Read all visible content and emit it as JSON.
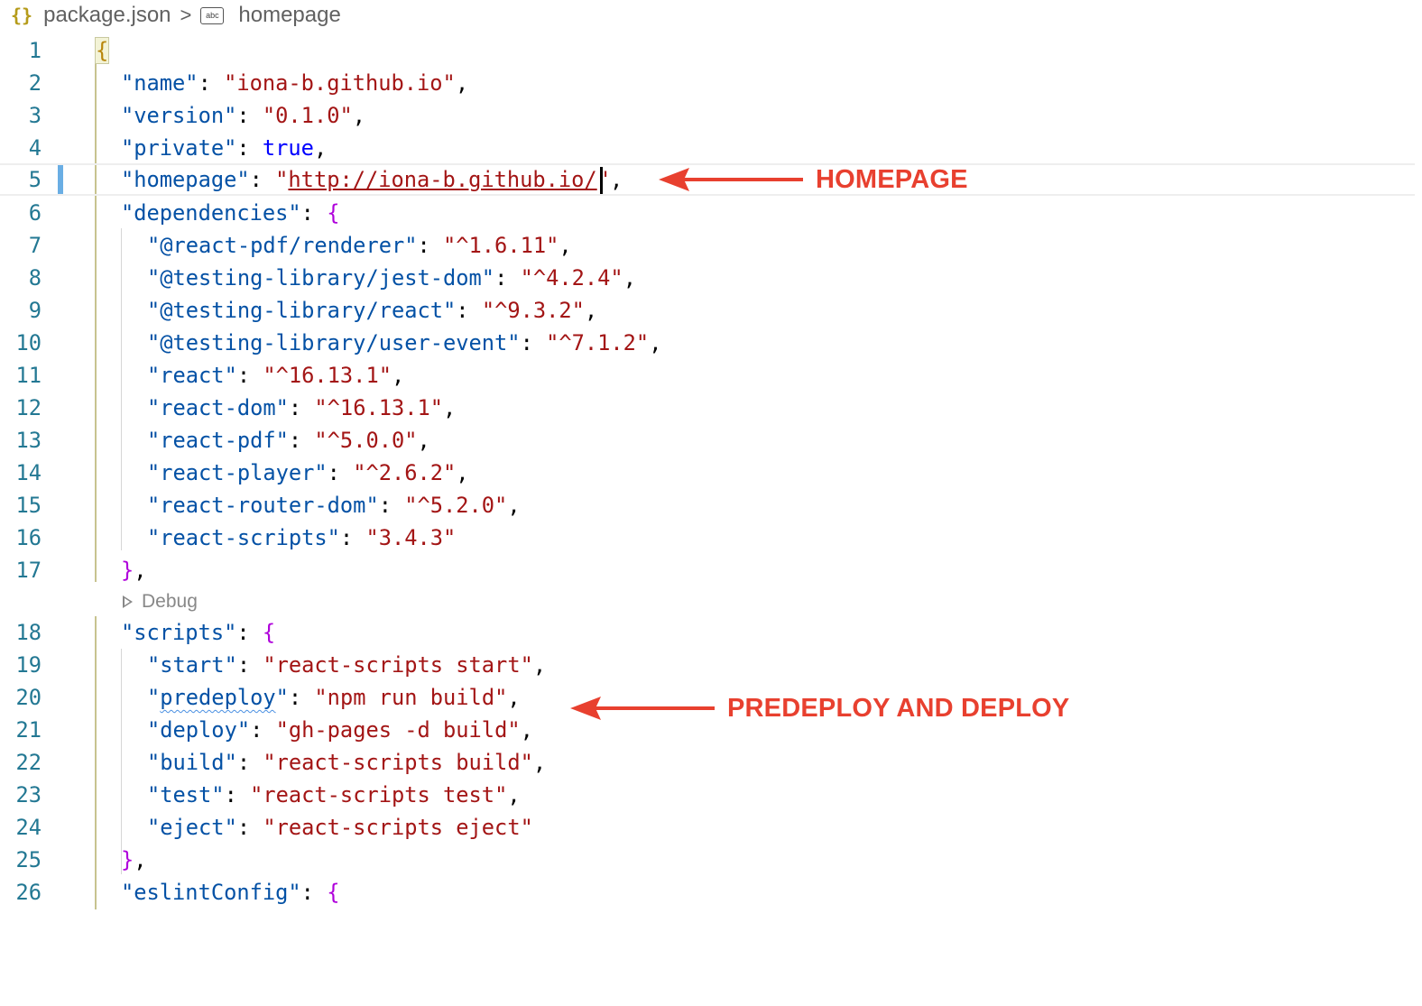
{
  "breadcrumb": {
    "file_icon": "{}",
    "file_name": "package.json",
    "separator": ">",
    "symbol_icon": "abc",
    "symbol_name": "homepage"
  },
  "editor": {
    "current_line": 5,
    "codelens": "Debug",
    "lines": [
      {
        "num": "1"
      },
      {
        "num": "2"
      },
      {
        "num": "3"
      },
      {
        "num": "4"
      },
      {
        "num": "5"
      },
      {
        "num": "6"
      },
      {
        "num": "7"
      },
      {
        "num": "8"
      },
      {
        "num": "9"
      },
      {
        "num": "10"
      },
      {
        "num": "11"
      },
      {
        "num": "12"
      },
      {
        "num": "13"
      },
      {
        "num": "14"
      },
      {
        "num": "15"
      },
      {
        "num": "16"
      },
      {
        "num": "17"
      },
      {
        "num": "18"
      },
      {
        "num": "19"
      },
      {
        "num": "20"
      },
      {
        "num": "21"
      },
      {
        "num": "22"
      },
      {
        "num": "23"
      },
      {
        "num": "24"
      },
      {
        "num": "25"
      },
      {
        "num": "26"
      }
    ],
    "code": {
      "l2_key": "\"name\"",
      "l2_val": "\"iona-b.github.io\"",
      "l3_key": "\"version\"",
      "l3_val": "\"0.1.0\"",
      "l4_key": "\"private\"",
      "l4_val": "true",
      "l5_key": "\"homepage\"",
      "l5_val": "http://iona-b.github.io/",
      "l6_key": "\"dependencies\"",
      "l7_key": "\"@react-pdf/renderer\"",
      "l7_val": "\"^1.6.11\"",
      "l8_key": "\"@testing-library/jest-dom\"",
      "l8_val": "\"^4.2.4\"",
      "l9_key": "\"@testing-library/react\"",
      "l9_val": "\"^9.3.2\"",
      "l10_key": "\"@testing-library/user-event\"",
      "l10_val": "\"^7.1.2\"",
      "l11_key": "\"react\"",
      "l11_val": "\"^16.13.1\"",
      "l12_key": "\"react-dom\"",
      "l12_val": "\"^16.13.1\"",
      "l13_key": "\"react-pdf\"",
      "l13_val": "\"^5.0.0\"",
      "l14_key": "\"react-player\"",
      "l14_val": "\"^2.6.2\"",
      "l15_key": "\"react-router-dom\"",
      "l15_val": "\"^5.2.0\"",
      "l16_key": "\"react-scripts\"",
      "l16_val": "\"3.4.3\"",
      "l18_key": "\"scripts\"",
      "l19_key": "\"start\"",
      "l19_val": "\"react-scripts start\"",
      "l20_key": "predeploy",
      "l20_val": "\"npm run build\"",
      "l21_key": "\"deploy\"",
      "l21_val": "\"gh-pages -d build\"",
      "l22_key": "\"build\"",
      "l22_val": "\"react-scripts build\"",
      "l23_key": "\"test\"",
      "l23_val": "\"react-scripts test\"",
      "l24_key": "\"eject\"",
      "l24_val": "\"react-scripts eject\"",
      "l26_key": "\"eslintConfig\""
    }
  },
  "annotations": {
    "homepage": "HOMEPAGE",
    "predeploy": "PREDEPLOY AND DEPLOY",
    "color": "#e8402f"
  },
  "colors": {
    "key": "#0451a5",
    "string": "#a31515",
    "keyword": "#0000ff",
    "line_number": "#237893",
    "modified_gutter": "#6aaee4"
  }
}
